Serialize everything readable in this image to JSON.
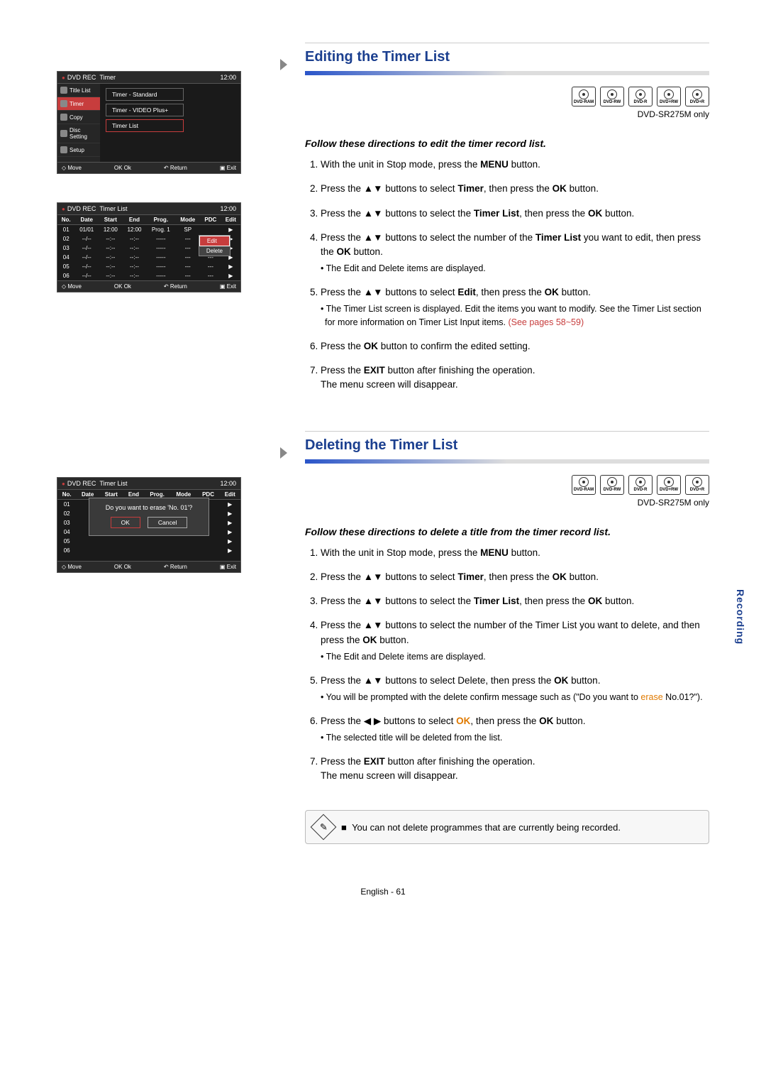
{
  "tab": "Recording",
  "footer": "English - 61",
  "shared": {
    "clock": "12:00",
    "rec_label": "DVD REC",
    "footer_bar": {
      "move": "◇ Move",
      "ok": "OK Ok",
      "ret": "↶ Return",
      "exit": "▣ Exit"
    },
    "discs": [
      "DVD-RAM",
      "DVD-RW",
      "DVD-R",
      "DVD+RW",
      "DVD+R"
    ],
    "model_note": "DVD-SR275M only"
  },
  "panel_menu": {
    "title": "Timer",
    "sidebar": [
      "Title List",
      "Timer",
      "Copy",
      "Disc Setting",
      "Setup"
    ],
    "opts": [
      "Timer - Standard",
      "Timer - VIDEO Plus+",
      "Timer List"
    ],
    "selected_opt": "Timer List"
  },
  "panel_list": {
    "title": "Timer List",
    "cols": [
      "No.",
      "Date",
      "Start",
      "End",
      "Prog.",
      "Mode",
      "PDC",
      "Edit"
    ],
    "rows": [
      {
        "no": "01",
        "date": "01/01",
        "start": "12:00",
        "end": "12:00",
        "prog": "Prog. 1",
        "mode": "SP",
        "pdc": ""
      },
      {
        "no": "02",
        "date": "--/--",
        "start": "--:--",
        "end": "--:--",
        "prog": "-----",
        "mode": "---",
        "pdc": "---"
      },
      {
        "no": "03",
        "date": "--/--",
        "start": "--:--",
        "end": "--:--",
        "prog": "-----",
        "mode": "---",
        "pdc": "---"
      },
      {
        "no": "04",
        "date": "--/--",
        "start": "--:--",
        "end": "--:--",
        "prog": "-----",
        "mode": "---",
        "pdc": "---"
      },
      {
        "no": "05",
        "date": "--/--",
        "start": "--:--",
        "end": "--:--",
        "prog": "-----",
        "mode": "---",
        "pdc": "---"
      },
      {
        "no": "06",
        "date": "--/--",
        "start": "--:--",
        "end": "--:--",
        "prog": "-----",
        "mode": "---",
        "pdc": "---"
      }
    ],
    "popup": {
      "edit": "Edit",
      "del": "Delete"
    }
  },
  "panel_confirm": {
    "title": "Timer List",
    "cols": [
      "No.",
      "Date",
      "Start",
      "End",
      "Prog.",
      "Mode",
      "PDC",
      "Edit"
    ],
    "nos": [
      "01",
      "02",
      "03",
      "04",
      "05",
      "06"
    ],
    "msg": "Do you want to erase 'No. 01'?",
    "ok": "OK",
    "cancel": "Cancel"
  },
  "s1": {
    "title": "Editing the Timer List",
    "subhead": "Follow these directions to edit the timer record list.",
    "step1a": "With the unit in Stop mode, press the ",
    "step1b": " button.",
    "btn_menu": "MENU",
    "step2a": "Press the ▲▼ buttons to select ",
    "step2b": ", then press the ",
    "step2c": " button.",
    "w_timer": "Timer",
    "w_ok": "OK",
    "step3a": "Press the ▲▼ buttons to select the ",
    "step3b": ", then press the ",
    "step3c": " button.",
    "w_tl": "Timer List",
    "step4a": "Press the ▲▼ buttons to select the number of the ",
    "step4b": " you want to edit, then press the ",
    "step4c": " button.",
    "step4_sub": "• The Edit and Delete items are displayed.",
    "step5a": "Press the ▲▼ buttons to select ",
    "step5b": ", then press the ",
    "step5c": " button.",
    "w_edit": "Edit",
    "step5_sub": "• The Timer List screen is displayed. Edit the items you want to modify. See the Timer List section for more information on Timer List Input items. ",
    "step5_link": "(See pages 58~59)",
    "step6a": "Press the ",
    "step6b": " button to confirm the edited setting.",
    "step7a": "Press the ",
    "step7b": " button after finishing the operation.",
    "w_exit": "EXIT",
    "step7c": "The menu screen will disappear."
  },
  "s2": {
    "title": "Deleting the Timer List",
    "subhead": "Follow these directions to delete a title from the timer record list.",
    "step4a": "Press the ▲▼ buttons to select the number of the Timer List you want to delete, and then press the ",
    "step4b": " button.",
    "step4_sub": "• The Edit and Delete items are displayed.",
    "step5a": "Press the ▲▼ buttons to select Delete, then press the ",
    "step5b": " button.",
    "step5_sub1": "• You will be prompted with the delete confirm message such as (\"Do you want to ",
    "step5_erase": "erase",
    "step5_sub2": " No.01?\").",
    "step6a": "Press the ◀ ▶ buttons to select ",
    "step6_ok": "OK",
    "step6b": ", then press the ",
    "step6c": " button.",
    "step6_sub": "• The selected title will be deleted from the list.",
    "note": "You can not delete programmes that are currently being recorded."
  }
}
